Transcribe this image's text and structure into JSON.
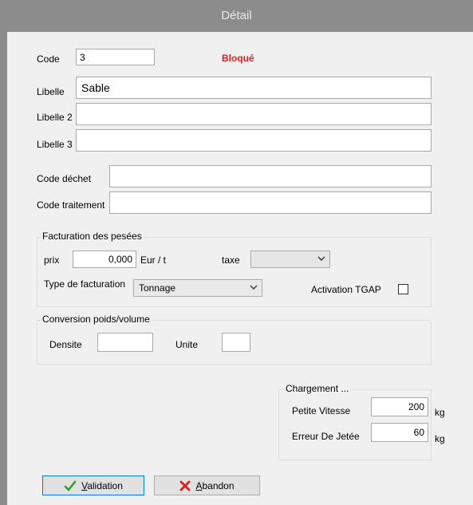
{
  "window": {
    "title": "Détail"
  },
  "code": {
    "label": "Code",
    "value": "3",
    "status": "Bloqué"
  },
  "libelle": {
    "label": "Libelle",
    "value": "Sable"
  },
  "libelle2": {
    "label": "Libelle 2",
    "value": ""
  },
  "libelle3": {
    "label": "Libelle 3",
    "value": ""
  },
  "code_dechet": {
    "label": "Code déchet",
    "value": ""
  },
  "code_traitement": {
    "label": "Code traitement",
    "value": ""
  },
  "facturation": {
    "title": "Facturation des pesées",
    "prix_label": "prix",
    "prix_value": "0,000",
    "prix_unit": "Eur / t",
    "taxe_label": "taxe",
    "taxe_value": "",
    "type_label": "Type de facturation",
    "type_value": "Tonnage",
    "tgap_label": "Activation TGAP",
    "tgap_checked": false
  },
  "conversion": {
    "title": "Conversion poids/volume",
    "densite_label": "Densite",
    "densite_value": "",
    "unite_label": "Unite",
    "unite_value": ""
  },
  "chargement": {
    "title": "Chargement ...",
    "petite_vitesse_label": "Petite Vitesse",
    "petite_vitesse_value": "200",
    "petite_vitesse_unit": "kg",
    "erreur_jetee_label": "Erreur De Jetée",
    "erreur_jetee_value": "60",
    "erreur_jetee_unit": "kg"
  },
  "buttons": {
    "validation_access": "V",
    "validation_rest": "alidation",
    "abandon_access": "A",
    "abandon_rest": "bandon"
  },
  "colors": {
    "status": "#e02020",
    "titlebar": "#8c8c8c",
    "check": "#2a9d2a",
    "cross": "#d42020"
  },
  "icons": {
    "validation": "checkmark-icon",
    "abandon": "cross-icon",
    "dropdown": "chevron-down-icon"
  }
}
